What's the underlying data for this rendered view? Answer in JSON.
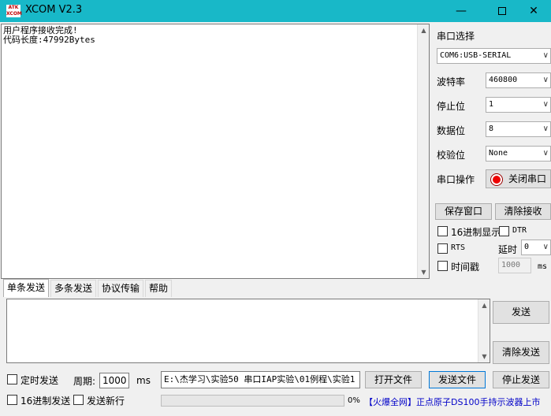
{
  "window": {
    "icon_text": "ATK XCOM",
    "title": "XCOM V2.3",
    "minimize": "—",
    "close": "✕"
  },
  "receive": {
    "text": "用户程序接收完成!\n代码长度:47992Bytes"
  },
  "serial": {
    "port_select_label": "串口选择",
    "port_value": "COM6:USB-SERIAL",
    "baud_label": "波特率",
    "baud_value": "460800",
    "stop_label": "停止位",
    "stop_value": "1",
    "data_label": "数据位",
    "data_value": "8",
    "parity_label": "校验位",
    "parity_value": "None",
    "op_label": "串口操作",
    "op_button": "关闭串口"
  },
  "recv_controls": {
    "save_button": "保存窗口",
    "clear_button": "清除接收",
    "hex_display_label": "16进制显示",
    "dtr_label": "DTR",
    "rts_label": "RTS",
    "delay_label": "延时",
    "delay_value": "0",
    "timestamp_label": "时间戳",
    "timestamp_value": "1000",
    "ms_label": "ms"
  },
  "tabs": [
    "单条发送",
    "多条发送",
    "协议传输",
    "帮助"
  ],
  "send": {
    "send_button": "发送",
    "clear_send_button": "清除发送",
    "timed_send_label": "定时发送",
    "period_label": "周期:",
    "period_value": "1000",
    "ms_label": "ms",
    "file_path": "E:\\杰学习\\实验50 串口IAP实验\\01例程\\实验1",
    "open_file_button": "打开文件",
    "send_file_button": "发送文件",
    "stop_send_button": "停止发送",
    "hex_send_label": "16进制发送",
    "newline_label": "发送新行",
    "progress_text": "0%",
    "progress_value": 0,
    "marquee": "【火爆全网】正点原子DS100手持示波器上市"
  }
}
